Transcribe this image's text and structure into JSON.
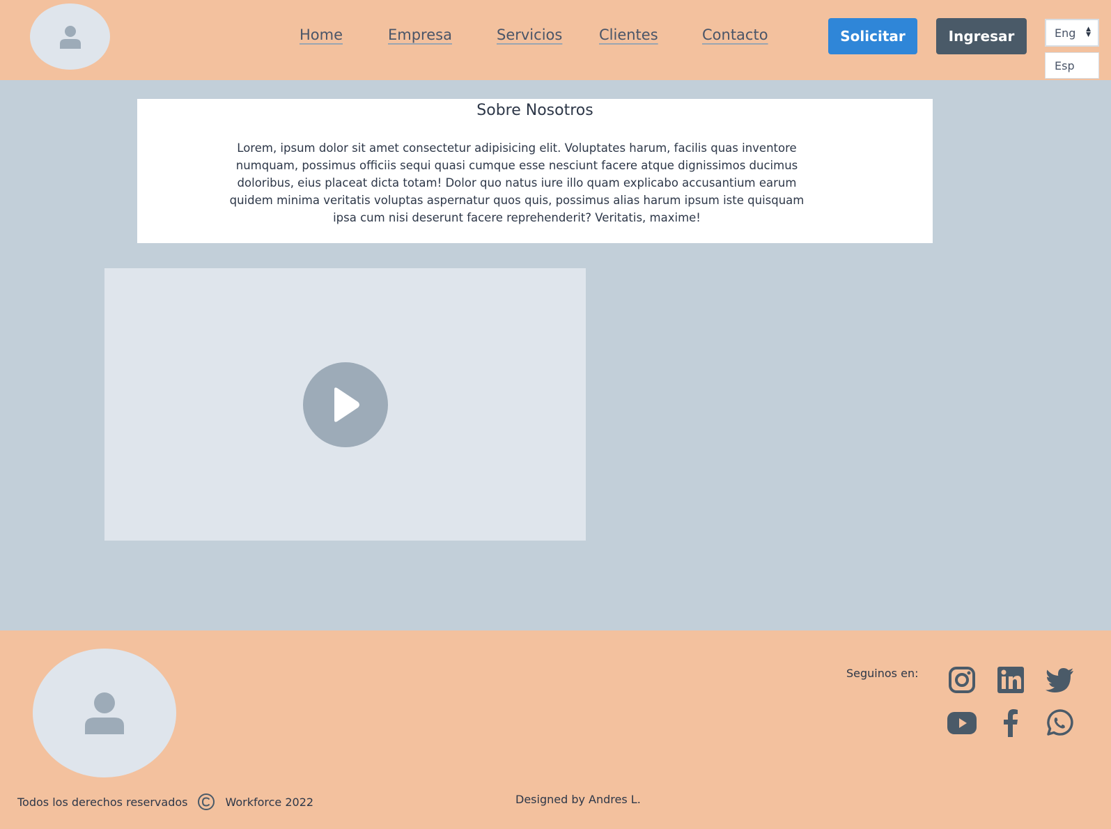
{
  "header": {
    "nav": [
      {
        "label": "Home"
      },
      {
        "label": "Empresa"
      },
      {
        "label": "Servicios"
      },
      {
        "label": "Clientes"
      },
      {
        "label": "Contacto"
      }
    ],
    "primary_button": "Solicitar",
    "secondary_button": "Ingresar",
    "language": {
      "selected": "Eng",
      "option": "Esp"
    }
  },
  "about": {
    "title": "Sobre Nosotros",
    "text": "Lorem, ipsum dolor sit amet consectetur adipisicing elit. Voluptates harum, facilis quas inventore numquam, possimus officiis sequi quasi cumque esse nesciunt facere atque dignissimos ducimus doloribus, eius placeat dicta totam! Dolor quo natus iure illo quam explicabo accusantium earum quidem minima veritatis voluptas aspernatur quos quis, possimus alias harum ipsum iste quisquam ipsa cum nisi deserunt facere reprehenderit? Veritatis, maxime!"
  },
  "video": {
    "icon": "play-icon"
  },
  "footer": {
    "follow_label": "Seguinos en:",
    "social_icons": [
      "instagram-icon",
      "linkedin-icon",
      "twitter-icon",
      "youtube-icon",
      "facebook-icon",
      "whatsapp-icon"
    ],
    "rights_text": "Todos los derechos reservados",
    "company": "Workforce 2022",
    "designer": "Designed by Andres L."
  },
  "colors": {
    "header_bg": "#f3c19e",
    "page_bg": "#c2cfd9",
    "primary": "#2f86d8",
    "dark": "#4a5a68",
    "placeholder": "#dfe5ec",
    "icon": "#4a5a68"
  }
}
